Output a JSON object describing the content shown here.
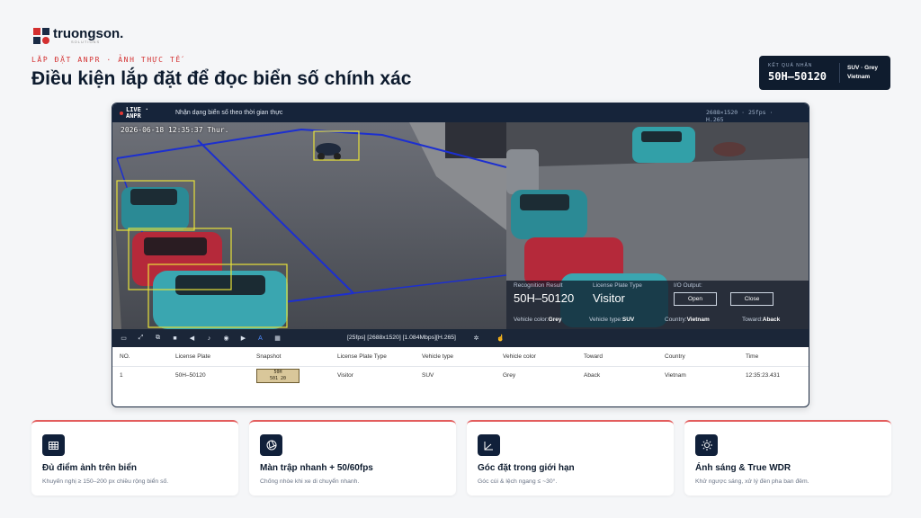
{
  "brand": {
    "name": "truongson.",
    "sub": "SOLUTIONS"
  },
  "header": {
    "eyebrow": "LẮP ĐẶT ANPR · ẢNH THỰC TẾ",
    "title": "Điều kiện lắp đặt để đọc biển số chính xác"
  },
  "result_card": {
    "label": "KẾT QUẢ NHẬN",
    "plate": "50H–50120",
    "line1": "SUV · Grey",
    "line2": "Vietnam"
  },
  "window": {
    "live": "LIVE ·",
    "live2": "ANPR",
    "caption": "Nhận dạng biển số theo thời gian thực",
    "resolution": "2688×1520 · 25fps · H.265",
    "timestamp": "2026-06-18 12:35:37 Thur."
  },
  "overlay": {
    "recognition_label": "Recognition Result",
    "recognition_value": "50H–50120",
    "type_label": "License Plate Type",
    "type_value": "Visitor",
    "io_label": "I/O Output:",
    "open": "Open",
    "close": "Close",
    "vehicle_color_label": "Vehicle color:",
    "vehicle_color": "Grey",
    "vehicle_type_label": "Vehicle type:",
    "vehicle_type": "SUV",
    "country_label": "Country:",
    "country": "Vietnam",
    "toward_label": "Toward:",
    "toward": "Aback"
  },
  "toolbar": {
    "stats": "[25fps] [2688x1520] [1.084Mbps][H.265]"
  },
  "table": {
    "headers": [
      "NO.",
      "License Plate",
      "Snapshot",
      "License Plate Type",
      "Vehicle type",
      "Vehicle color",
      "Toward",
      "Country",
      "Time"
    ],
    "row": {
      "no": "1",
      "plate": "50H–50120",
      "snapshot_l1": "50H",
      "snapshot_l2": "501 20",
      "type": "Visitor",
      "vehicle": "SUV",
      "color": "Grey",
      "toward": "Aback",
      "country": "Vietnam",
      "time": "12:35:23.431"
    }
  },
  "cards": [
    {
      "icon": "grid-icon",
      "title": "Đủ điểm ảnh trên biển",
      "desc": "Khuyến nghị ≥ 150–200 px chiều rộng biển số."
    },
    {
      "icon": "shutter-icon",
      "title": "Màn trập nhanh + 50/60fps",
      "desc": "Chống nhòe khi xe di chuyển nhanh."
    },
    {
      "icon": "angle-icon",
      "title": "Góc đặt trong giới hạn",
      "desc": "Góc cúi & lệch ngang ≤ ~30°."
    },
    {
      "icon": "sun-icon",
      "title": "Ánh sáng & True WDR",
      "desc": "Khử ngược sáng, xử lý đèn pha ban đêm."
    }
  ],
  "colors": {
    "accent": "#d32f2f",
    "navy": "#0f1c2e"
  }
}
